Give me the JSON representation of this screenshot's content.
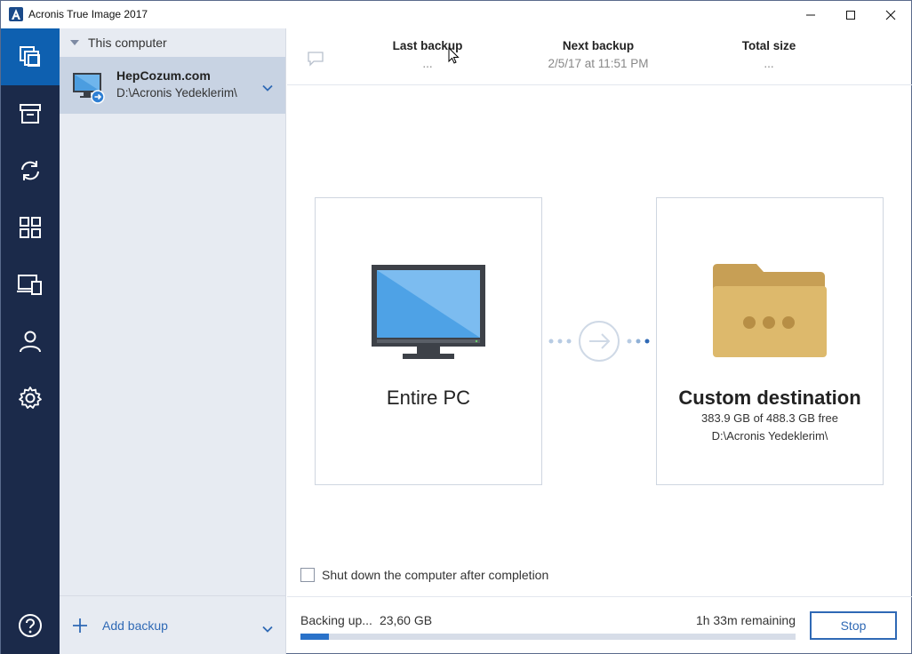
{
  "window": {
    "title": "Acronis True Image 2017"
  },
  "sidebar_rail": {
    "items": [
      {
        "icon": "backup-icon",
        "active": true
      },
      {
        "icon": "archive-icon"
      },
      {
        "icon": "sync-icon"
      },
      {
        "icon": "dashboard-icon"
      },
      {
        "icon": "devices-icon"
      },
      {
        "icon": "account-icon"
      },
      {
        "icon": "settings-icon"
      },
      {
        "icon": "help-icon"
      }
    ]
  },
  "backup_list": {
    "group_label": "This computer",
    "items": [
      {
        "name": "HepCozum.com",
        "destination": "D:\\Acronis Yedeklerim\\"
      }
    ],
    "add_label": "Add backup"
  },
  "header": {
    "last_backup_label": "Last backup",
    "last_backup_value": "...",
    "next_backup_label": "Next backup",
    "next_backup_value": "2/5/17 at 11:51 PM",
    "total_size_label": "Total size",
    "total_size_value": "..."
  },
  "source": {
    "title": "Entire PC"
  },
  "destination": {
    "title": "Custom destination",
    "free_space": "383.9 GB of 488.3 GB free",
    "path": "D:\\Acronis Yedeklerim\\"
  },
  "options": {
    "shutdown_label": "Shut down the computer after completion",
    "shutdown_checked": false
  },
  "progress": {
    "status": "Backing up...",
    "size": "23,60 GB",
    "remaining": "1h 33m remaining",
    "fraction": 0.058,
    "stop_label": "Stop"
  },
  "colors": {
    "rail_bg": "#1b2a4a",
    "rail_active": "#0e60b0",
    "accent": "#2f69b5",
    "folder": "#d9b56a"
  }
}
